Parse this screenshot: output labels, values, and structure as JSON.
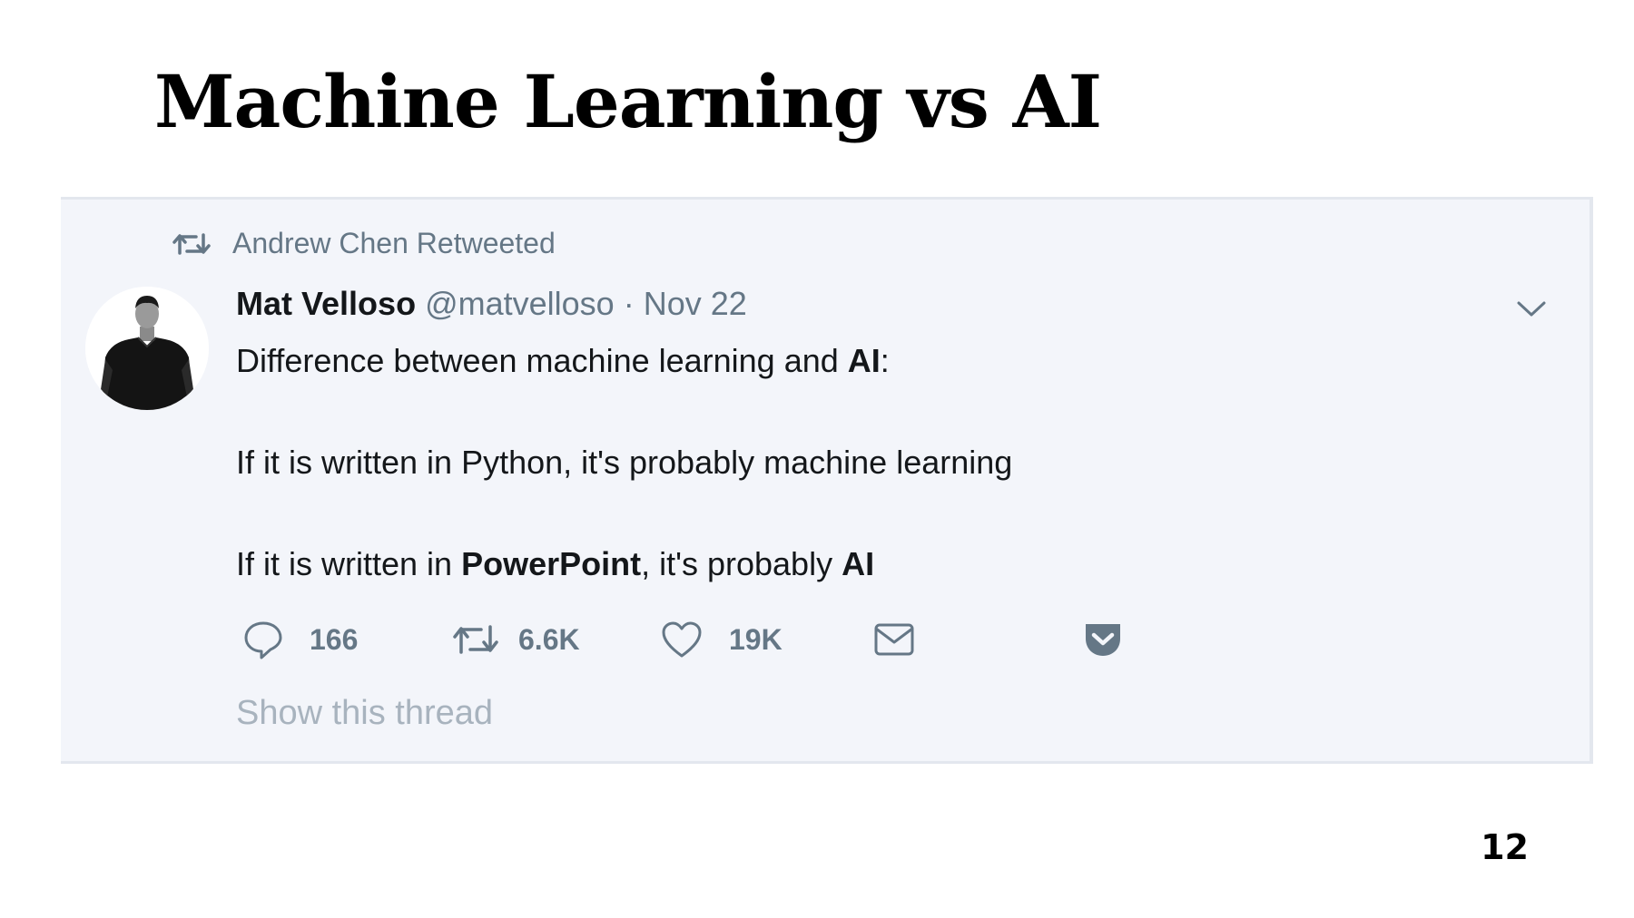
{
  "slide": {
    "title": "Machine Learning vs AI",
    "page_number": "12"
  },
  "tweet": {
    "retweet_context": "Andrew Chen Retweeted",
    "author_name": "Mat Velloso",
    "author_handle": "@matvelloso",
    "separator": "·",
    "date": "Nov 22",
    "text": {
      "line1_prefix": "Difference between machine learning and ",
      "line1_bold": "AI",
      "line1_suffix": ":",
      "line2": "If it is written in Python, it's probably machine learning",
      "line3_prefix": "If it is written in ",
      "line3_bold1": "PowerPoint",
      "line3_middle": ", it's probably ",
      "line3_bold2": "AI"
    },
    "actions": {
      "replies": "166",
      "retweets": "6.6K",
      "likes": "19K"
    },
    "show_thread": "Show this thread",
    "icons": [
      "retweet-icon",
      "chevron-down-icon",
      "reply-icon",
      "retweet-icon",
      "like-icon",
      "message-icon",
      "pocket-icon"
    ]
  },
  "colors": {
    "card_background": "#f3f5fa",
    "secondary_text": "#657786",
    "primary_text": "#14171a",
    "muted_link": "#a8b3be"
  }
}
